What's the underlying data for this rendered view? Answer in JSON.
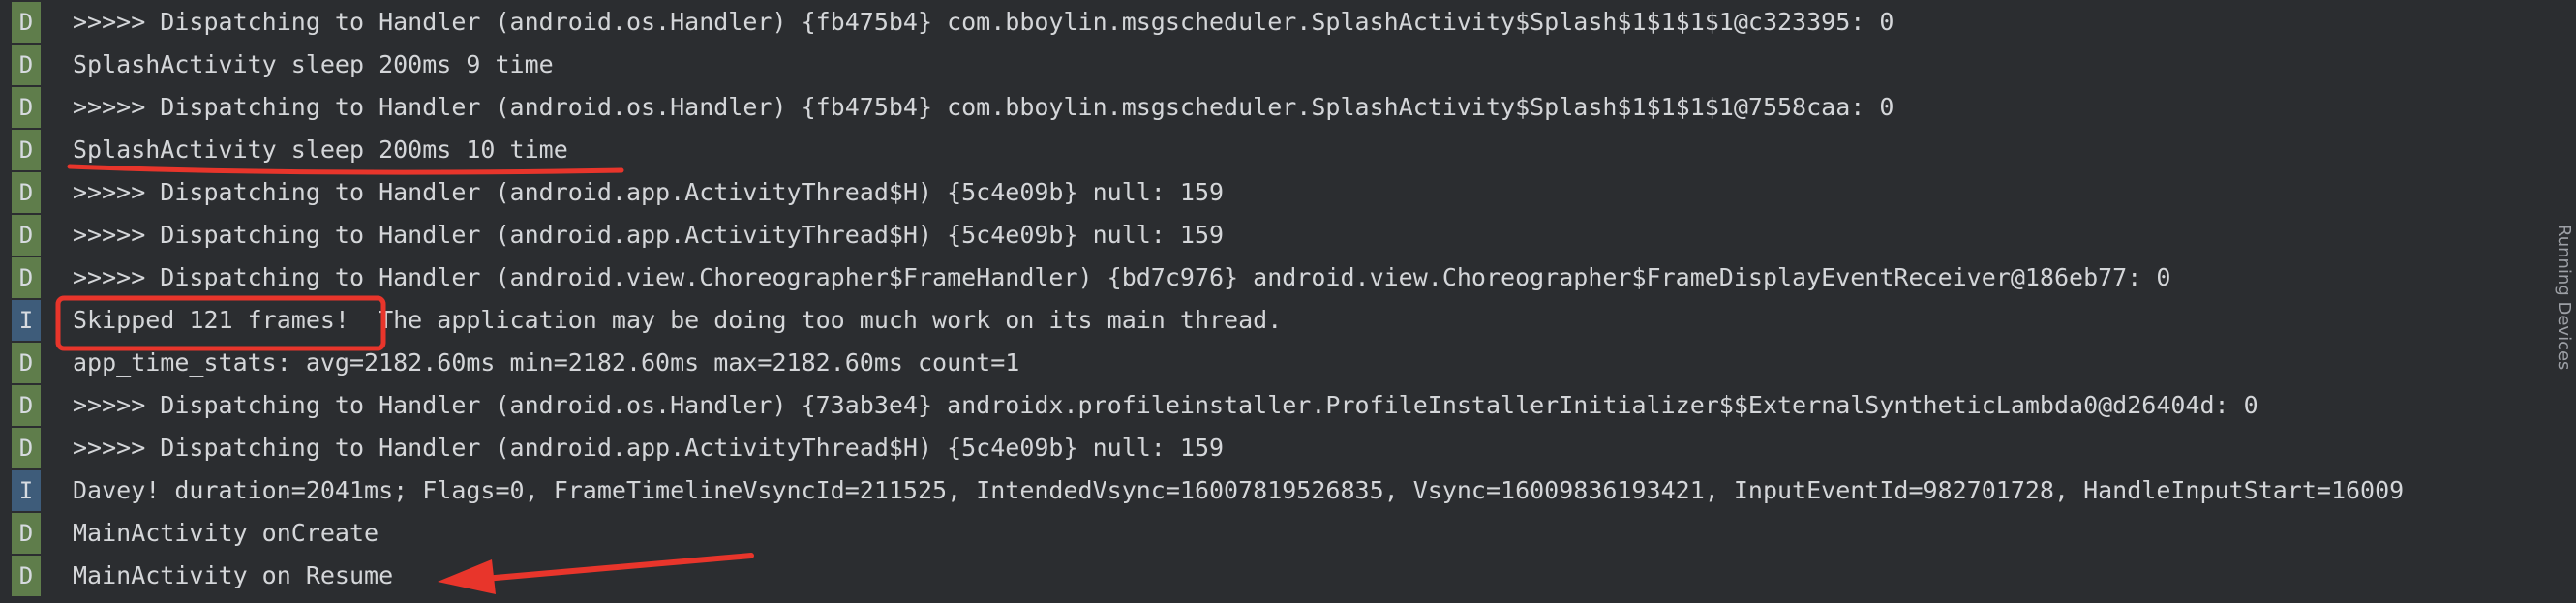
{
  "logcat": {
    "rows": [
      {
        "level": "D",
        "message": ">>>>> Dispatching to Handler (android.os.Handler) {fb475b4} com.bboylin.msgscheduler.SplashActivity$Splash$1$1$1$1@c323395: 0"
      },
      {
        "level": "D",
        "message": "SplashActivity sleep 200ms 9 time"
      },
      {
        "level": "D",
        "message": ">>>>> Dispatching to Handler (android.os.Handler) {fb475b4} com.bboylin.msgscheduler.SplashActivity$Splash$1$1$1$1@7558caa: 0"
      },
      {
        "level": "D",
        "message": "SplashActivity sleep 200ms 10 time"
      },
      {
        "level": "D",
        "message": ">>>>> Dispatching to Handler (android.app.ActivityThread$H) {5c4e09b} null: 159"
      },
      {
        "level": "D",
        "message": ">>>>> Dispatching to Handler (android.app.ActivityThread$H) {5c4e09b} null: 159"
      },
      {
        "level": "D",
        "message": ">>>>> Dispatching to Handler (android.view.Choreographer$FrameHandler) {bd7c976} android.view.Choreographer$FrameDisplayEventReceiver@186eb77: 0"
      },
      {
        "level": "I",
        "message": "Skipped 121 frames!  The application may be doing too much work on its main thread."
      },
      {
        "level": "D",
        "message": "app_time_stats: avg=2182.60ms min=2182.60ms max=2182.60ms count=1"
      },
      {
        "level": "D",
        "message": ">>>>> Dispatching to Handler (android.os.Handler) {73ab3e4} androidx.profileinstaller.ProfileInstallerInitializer$$ExternalSyntheticLambda0@d26404d: 0"
      },
      {
        "level": "D",
        "message": ">>>>> Dispatching to Handler (android.app.ActivityThread$H) {5c4e09b} null: 159"
      },
      {
        "level": "I",
        "message": "Davey! duration=2041ms; Flags=0, FrameTimelineVsyncId=211525, IntendedVsync=16007819526835, Vsync=16009836193421, InputEventId=982701728, HandleInputStart=16009"
      },
      {
        "level": "D",
        "message": "MainActivity onCreate"
      },
      {
        "level": "D",
        "message": "MainActivity on Resume"
      }
    ],
    "side_panel_label": "Running Devices",
    "colors": {
      "background": "#2b2d30",
      "debug_badge": "#5f7d4b",
      "info_badge": "#3e5c7a",
      "annotation": "#e8352b"
    }
  }
}
